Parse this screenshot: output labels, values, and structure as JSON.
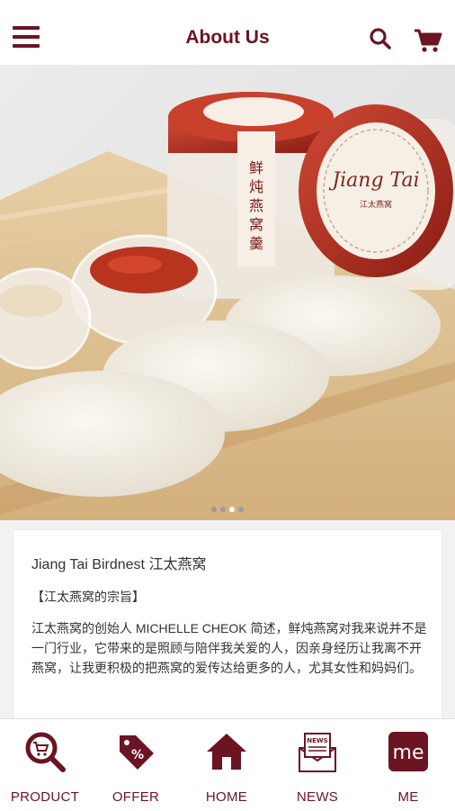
{
  "header": {
    "title": "About Us",
    "icons": {
      "menu": "menu-icon",
      "search": "search-icon",
      "cart": "cart-icon"
    }
  },
  "hero": {
    "jar_label_text": "鲜炖燕窝羹",
    "brand_logo_text": "Jiang Tai",
    "brand_logo_sub": "江太燕窝",
    "carousel_total": 4,
    "carousel_active": 3
  },
  "about": {
    "title": "Jiang Tai Birdnest 江太燕窝",
    "subtitle": "【江太燕窝的宗旨】",
    "body": "江太燕窝的创始人 MICHELLE CHEOK 简述，鲜炖燕窝对我来说并不是一门行业，它带来的是照顾与陪伴我关爱的人，因亲身经历让我离不开燕窝，让我更积极的把燕窝的爱传达给更多的人，尤其女性和妈妈们。"
  },
  "bottom_nav": {
    "product": "PRODUCT",
    "offer": "OFFER",
    "home": "HOME",
    "news": "NEWS",
    "me": "ME",
    "news_icon_text": "NEWS",
    "me_icon_text": "me"
  },
  "colors": {
    "brand": "#6b1422",
    "background": "#f2f2f2"
  }
}
